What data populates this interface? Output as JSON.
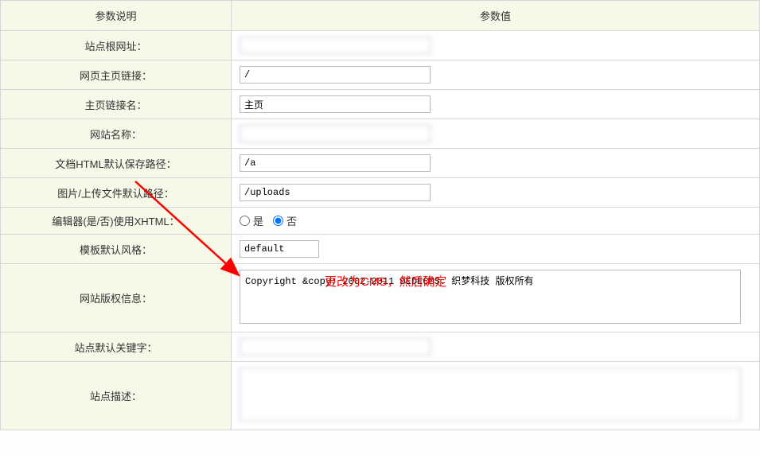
{
  "headers": {
    "param_desc": "参数说明",
    "param_value": "参数值"
  },
  "rows": {
    "site_root_url": {
      "label": "站点根网址：",
      "value": ""
    },
    "home_link": {
      "label": "网页主页链接：",
      "value": "/"
    },
    "home_link_name": {
      "label": "主页链接名：",
      "value": "主页"
    },
    "site_name": {
      "label": "网站名称：",
      "value": ""
    },
    "html_path": {
      "label": "文档HTML默认保存路径：",
      "value": "/a"
    },
    "upload_path": {
      "label": "图片/上传文件默认路径：",
      "value": "/uploads"
    },
    "editor_xhtml": {
      "label": "编辑器(是/否)使用XHTML：",
      "yes": "是",
      "no": "否"
    },
    "template_style": {
      "label": "模板默认风格：",
      "value": "default"
    },
    "copyright": {
      "label": "网站版权信息：",
      "value": "Copyright &copy; 2002-2011 DEDECMS. 织梦科技 版权所有"
    },
    "keywords": {
      "label": "站点默认关键字：",
      "value": ""
    },
    "description": {
      "label": "站点描述：",
      "value": ""
    }
  },
  "annotation": {
    "text": "更改为CMS，然后确定"
  }
}
